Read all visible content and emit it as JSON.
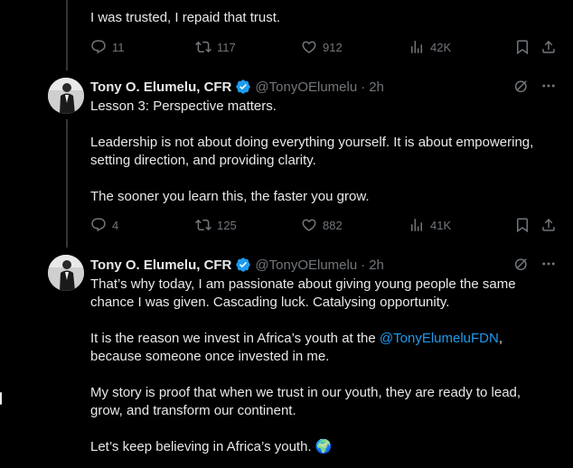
{
  "tweets": [
    {
      "text": [
        "I was trusted, I repaid that trust."
      ],
      "stats": {
        "replies": "11",
        "retweets": "117",
        "likes": "912",
        "views": "42K"
      }
    },
    {
      "author": {
        "name": "Tony O. Elumelu, CFR",
        "handle": "@TonyOElumelu",
        "time": "2h"
      },
      "text": [
        "Lesson 3: Perspective matters.",
        "",
        "Leadership is not about doing everything yourself. It is about empowering, setting direction, and providing clarity.",
        "",
        "The sooner you learn this, the faster you grow."
      ],
      "stats": {
        "replies": "4",
        "retweets": "125",
        "likes": "882",
        "views": "41K"
      }
    },
    {
      "author": {
        "name": "Tony O. Elumelu, CFR",
        "handle": "@TonyOElumelu",
        "time": "2h"
      },
      "text": {
        "p1": "That’s why today, I am passionate about giving young people the same chance I was given. Cascading luck. Catalysing opportunity.",
        "p2_before": "It is the reason we invest in Africa’s youth at the ",
        "p2_mention": "@TonyElumeluFDN",
        "p2_after": ", because someone once invested in me.",
        "p3": "My story is proof that when we trust in our youth, they are ready to lead, grow, and transform our continent.",
        "p4": "Let’s keep believing in Africa’s youth.",
        "p4_emoji": "🌍"
      }
    }
  ],
  "colors": {
    "accent": "#1d9bf0",
    "muted": "#71767b",
    "text": "#e7e9ea",
    "background": "#000000"
  },
  "icons": [
    "reply-icon",
    "retweet-icon",
    "like-icon",
    "views-icon",
    "bookmark-icon",
    "share-icon",
    "grok-icon",
    "more-icon",
    "verified-badge-icon"
  ]
}
